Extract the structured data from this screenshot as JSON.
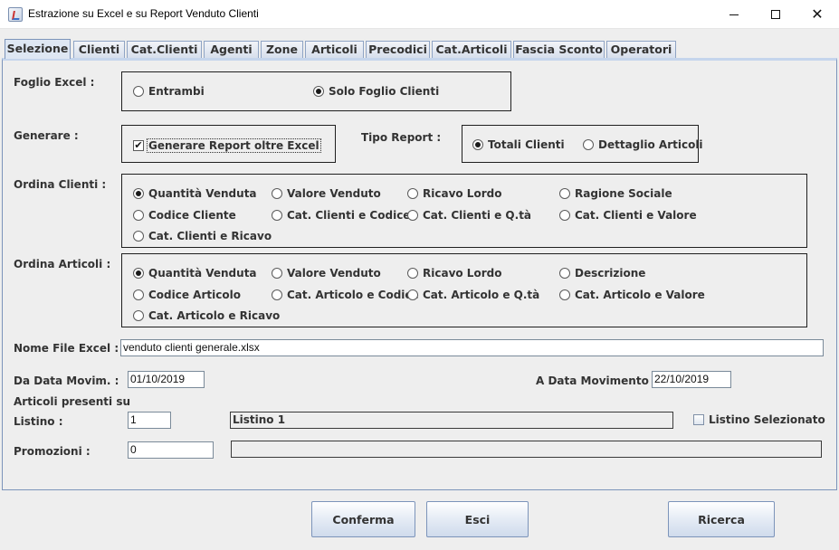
{
  "window": {
    "title": "Estrazione su Excel e su Report Venduto Clienti"
  },
  "tabs": [
    {
      "label": "Selezione"
    },
    {
      "label": "Clienti"
    },
    {
      "label": "Cat.Clienti"
    },
    {
      "label": "Agenti"
    },
    {
      "label": "Zone"
    },
    {
      "label": "Articoli"
    },
    {
      "label": "Precodici"
    },
    {
      "label": "Cat.Articoli"
    },
    {
      "label": "Fascia Sconto"
    },
    {
      "label": "Operatori"
    }
  ],
  "foglio_excel": {
    "label": "Foglio Excel  :",
    "options": [
      "Entrambi",
      "Solo Foglio Clienti"
    ],
    "selected": "Solo Foglio Clienti"
  },
  "generare": {
    "label": "Generare :",
    "checkbox_label": "Generare Report oltre Excel",
    "checked": true
  },
  "tipo_report": {
    "label": "Tipo Report :",
    "options": [
      "Totali Clienti",
      "Dettaglio Articoli"
    ],
    "selected": "Totali Clienti"
  },
  "ordina_clienti": {
    "label": "Ordina  Clienti :",
    "options": [
      "Quantità Venduta",
      "Valore Venduto",
      "Ricavo Lordo",
      "Ragione Sociale",
      "Codice Cliente",
      "Cat. Clienti e Codice",
      "Cat. Clienti e Q.tà",
      "Cat. Clienti e Valore",
      "Cat. Clienti e Ricavo"
    ],
    "selected": "Quantità Venduta"
  },
  "ordina_articoli": {
    "label": "Ordina  Articoli :",
    "options": [
      "Quantità Venduta",
      "Valore Venduto",
      "Ricavo Lordo",
      "Descrizione",
      "Codice Articolo",
      "Cat. Articolo e Codice",
      "Cat. Articolo e Q.tà",
      "Cat. Articolo e Valore",
      "Cat. Articolo e Ricavo"
    ],
    "selected": "Quantità Venduta"
  },
  "nome_file": {
    "label": "Nome File Excel :",
    "value": "venduto clienti generale.xlsx"
  },
  "da_data": {
    "label": "Da Data Movim. :",
    "value": "01/10/2019"
  },
  "a_data": {
    "label": "A  Data Movimento :",
    "value": "22/10/2019"
  },
  "articoli_presenti": {
    "label": "Articoli presenti su"
  },
  "listino": {
    "label": "Listino :",
    "value": "1",
    "name": "Listino 1",
    "checkbox_label": "Listino Selezionato",
    "checked": false
  },
  "promozioni": {
    "label": "Promozioni :",
    "value": "0",
    "name": ""
  },
  "buttons": {
    "conferma": "Conferma",
    "esci": "Esci",
    "ricerca": "Ricerca"
  },
  "icons": {
    "app": "java-cup-icon",
    "minimize": "minimize-icon",
    "maximize": "maximize-icon",
    "close": "close-icon",
    "check_mark": "✔"
  }
}
